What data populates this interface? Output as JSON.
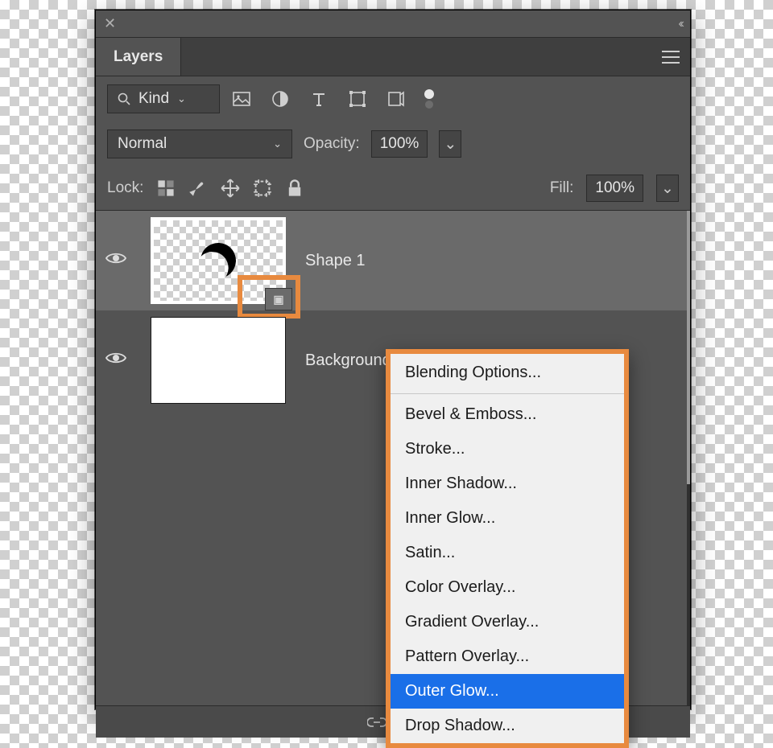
{
  "panel": {
    "tab_label": "Layers",
    "filter": {
      "kind_label": "Kind",
      "icons": [
        "image-icon",
        "adjustment-icon",
        "type-icon",
        "shape-icon",
        "smartobject-icon"
      ]
    },
    "blend": {
      "mode": "Normal",
      "opacity_label": "Opacity:",
      "opacity_value": "100%"
    },
    "lock": {
      "label": "Lock:",
      "fill_label": "Fill:",
      "fill_value": "100%"
    },
    "layers": [
      {
        "name": "Shape 1",
        "selected": true,
        "smart": true
      },
      {
        "name": "Background",
        "selected": false,
        "smart": false
      }
    ]
  },
  "context_menu": {
    "items": [
      "Blending Options...",
      "Bevel & Emboss...",
      "Stroke...",
      "Inner Shadow...",
      "Inner Glow...",
      "Satin...",
      "Color Overlay...",
      "Gradient Overlay...",
      "Pattern Overlay...",
      "Outer Glow...",
      "Drop Shadow..."
    ],
    "highlighted": "Outer Glow..."
  },
  "colors": {
    "highlight_orange": "#e88a3f",
    "selection_blue": "#1a6fe8",
    "panel_bg": "#535353"
  }
}
